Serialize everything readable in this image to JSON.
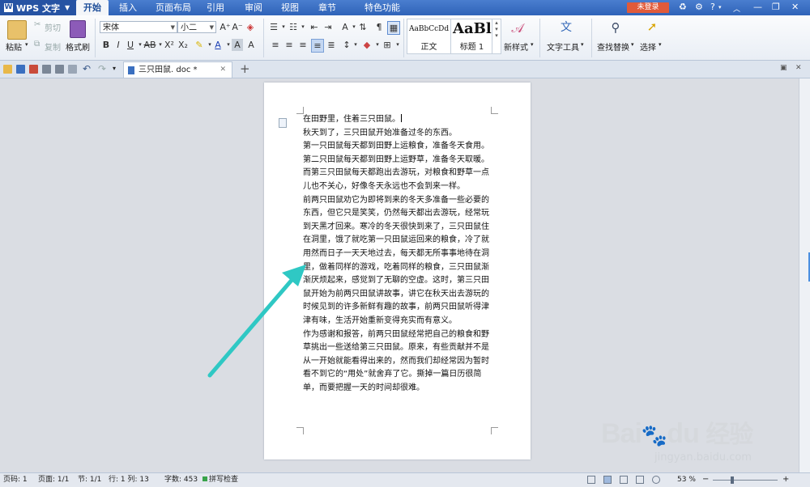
{
  "menubar": {
    "app_name": "WPS 文字",
    "app_letter": "W",
    "tabs": [
      "开始",
      "插入",
      "页面布局",
      "引用",
      "审阅",
      "视图",
      "章节",
      "特色功能"
    ],
    "active_tab": "开始",
    "login_label": "未登录"
  },
  "ribbon": {
    "paste": "粘贴",
    "cut": "剪切",
    "copy": "复制",
    "format_painter": "格式刷",
    "font_name": "宋体",
    "font_size": "小二",
    "style_normal_sample": "AaBbCcDd",
    "style_normal_label": "正文",
    "style_h1_sample": "AaBl",
    "style_h1_label": "标题 1",
    "new_style": "新样式",
    "text_tools": "文字工具",
    "find_replace": "查找替换",
    "select": "选择"
  },
  "doc_tab": {
    "title": "三只田鼠. doc *"
  },
  "document": {
    "lines": [
      "在田野里，住着三只田鼠。",
      "秋天到了，三只田鼠开始准备过冬的东西。",
      "第一只田鼠每天都到田野上运粮食，准备冬天食用。",
      "第二只田鼠每天都到田野上运野草，准备冬天取暖。",
      "而第三只田鼠每天都跑出去游玩，对粮食和野草一点",
      "儿也不关心，好像冬天永远也不会到来一样。",
      "前两只田鼠劝它为即将到来的冬天多准备一些必要的",
      "东西，但它只是笑笑，仍然每天都出去游玩，经常玩",
      "到天黑才回来。寒冷的冬天很快到来了，三只田鼠住",
      "在洞里，饿了就吃第一只田鼠运回来的粮食，冷了就",
      "用然而日子一天天地过去，每天都无所事事地待在洞",
      "里，做着同样的游戏，吃着同样的粮食，三只田鼠渐",
      "渐厌烦起来，感觉到了无聊的空虚。这时，第三只田",
      "鼠开始为前两只田鼠讲故事，讲它在秋天出去游玩的",
      "时候见到的许多新鲜有趣的故事，前两只田鼠听得津",
      "津有味，生活开始重新变得充实而有意义。",
      "作为感谢和报答，前两只田鼠经常把自己的粮食和野",
      "草挑出一些送给第三只田鼠。原来，有些贡献并不是",
      "从一开始就能看得出来的，然而我们却经常因为暂时",
      "看不到它的“用处”就舍弃了它。撕掉一篇日历很简",
      "单，而要把握一天的时间却很难。"
    ]
  },
  "statusbar": {
    "page_no": "页码: 1",
    "pages": "页面: 1/1",
    "section": "节: 1/1",
    "row_col": "行: 1  列: 13",
    "word_count": "字数: 453",
    "spell_check": "拼写检查",
    "zoom": "53 %"
  },
  "watermark": {
    "brand": "Bai",
    "brand2": "du",
    "cn": "经验",
    "url": "jingyan.baidu.com"
  },
  "colors": {
    "menubar_blue": "#2f63b8",
    "login_red": "#e05a3a",
    "annotation_cyan": "#2fc8c4",
    "watermark": "#d5d8dc"
  }
}
